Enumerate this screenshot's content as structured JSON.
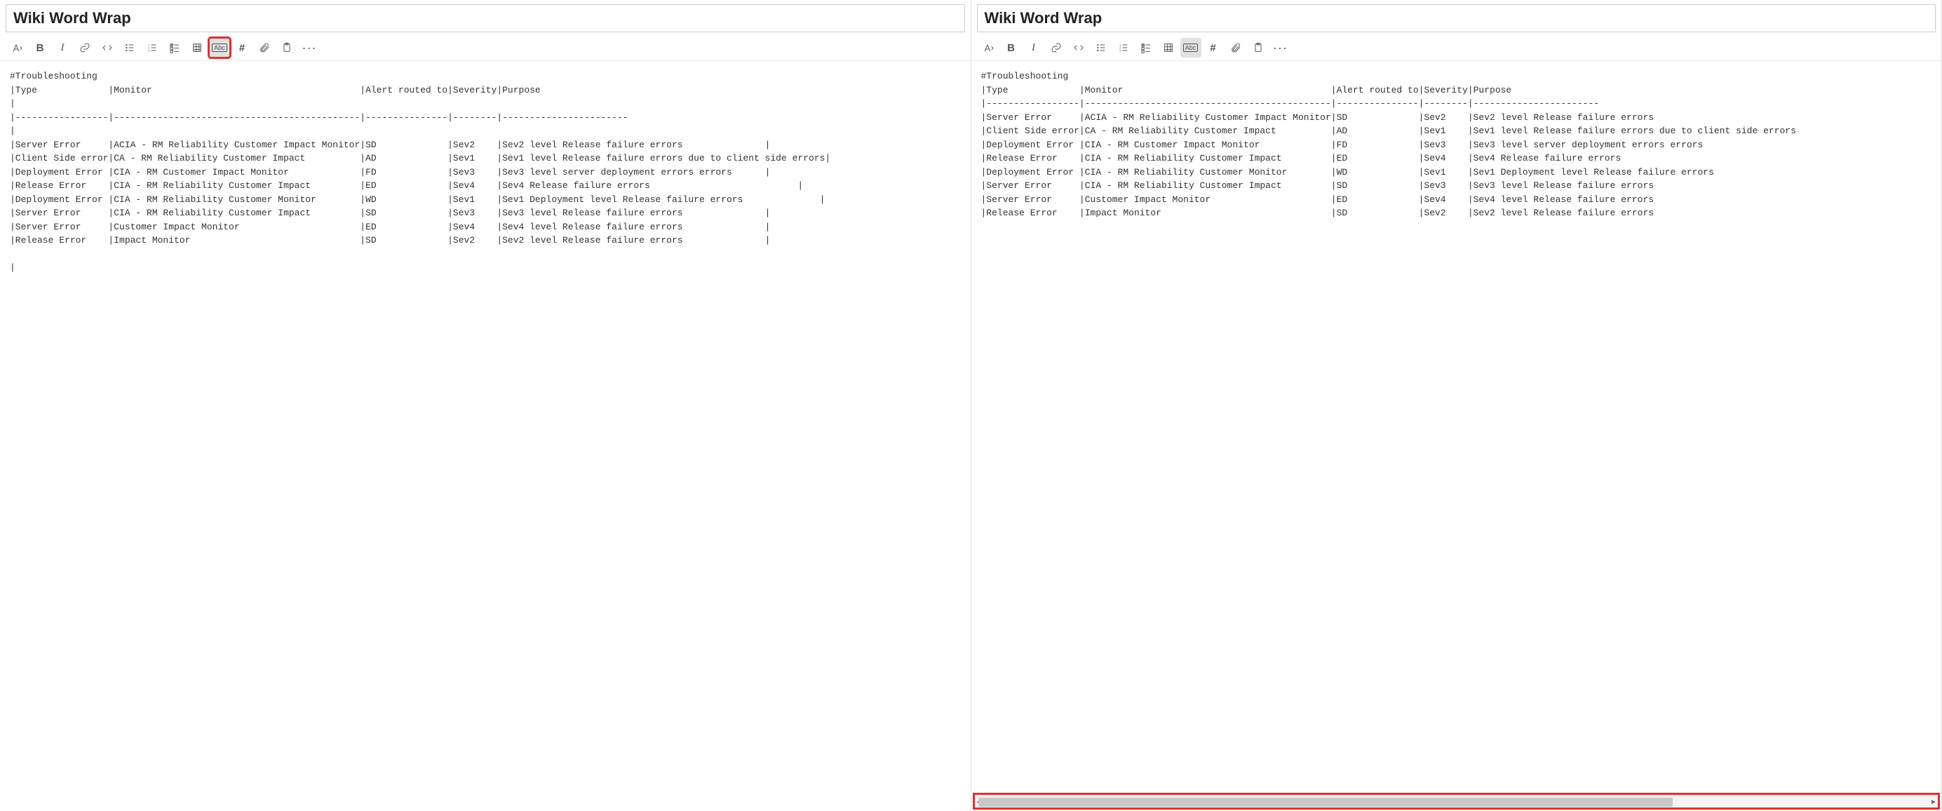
{
  "title": "Wiki Word Wrap",
  "toolbar": {
    "format_label": "Format",
    "bold_label": "B",
    "italic_label": "I",
    "hash_label": "#",
    "abc_label": "Abc",
    "more_label": "···"
  },
  "left_content": "#Troubleshooting\n|Type             |Monitor                                      |Alert routed to|Severity|Purpose\n|\n|-----------------|---------------------------------------------|---------------|--------|-----------------------\n|\n|Server Error     |ACIA - RM Reliability Customer Impact Monitor|SD             |Sev2    |Sev2 level Release failure errors               |\n|Client Side error|CA - RM Reliability Customer Impact          |AD             |Sev1    |Sev1 level Release failure errors due to client side errors|\n|Deployment Error |CIA - RM Customer Impact Monitor             |FD             |Sev3    |Sev3 level server deployment errors errors      |\n|Release Error    |CIA - RM Reliability Customer Impact         |ED             |Sev4    |Sev4 Release failure errors                           |\n|Deployment Error |CIA - RM Reliability Customer Monitor        |WD             |Sev1    |Sev1 Deployment level Release failure errors              |\n|Server Error     |CIA - RM Reliability Customer Impact         |SD             |Sev3    |Sev3 level Release failure errors               |\n|Server Error     |Customer Impact Monitor                      |ED             |Sev4    |Sev4 level Release failure errors               |\n|Release Error    |Impact Monitor                               |SD             |Sev2    |Sev2 level Release failure errors               |\n\n",
  "right_content": "#Troubleshooting\n|Type             |Monitor                                      |Alert routed to|Severity|Purpose\n|-----------------|---------------------------------------------|---------------|--------|-----------------------\n|Server Error     |ACIA - RM Reliability Customer Impact Monitor|SD             |Sev2    |Sev2 level Release failure errors\n|Client Side error|CA - RM Reliability Customer Impact          |AD             |Sev1    |Sev1 level Release failure errors due to client side errors\n|Deployment Error |CIA - RM Customer Impact Monitor             |FD             |Sev3    |Sev3 level server deployment errors errors\n|Release Error    |CIA - RM Reliability Customer Impact         |ED             |Sev4    |Sev4 Release failure errors\n|Deployment Error |CIA - RM Reliability Customer Monitor        |WD             |Sev1    |Sev1 Deployment level Release failure errors\n|Server Error     |CIA - RM Reliability Customer Impact         |SD             |Sev3    |Sev3 level Release failure errors\n|Server Error     |Customer Impact Monitor                      |ED             |Sev4    |Sev4 level Release failure errors\n|Release Error    |Impact Monitor                               |SD             |Sev2    |Sev2 level Release failure errors\n"
}
